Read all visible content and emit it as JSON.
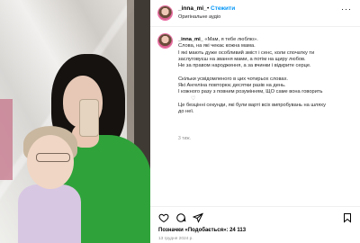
{
  "header": {
    "username": "_inna_mi_",
    "separator": "•",
    "follow_label": "Стежити",
    "audio_label": "Оригінальне аудіо",
    "more_icon": "more-horizontal-icon"
  },
  "caption": {
    "username": "_inna_mi_",
    "lines": [
      "«Мам, я тебе люблю».",
      "Слова, на які чекає кожна мама.",
      "І які мають дуже особливий зміст і сенс, коли спочатку ти",
      "заслуговуєш на звання мами, а потім на щиру любов.",
      "Не за правом народження, а за вчинки і відкрите серце.",
      "Скільки усвідомленого в цих чотирьох словах.",
      "Які Ангеліна повторює десятки разів на день.",
      "І кожного разу з повним розумінням, ЩО саме вона говорить",
      "Це безцінні секунди, які були варті всіх випробувань на шляху",
      "до неї."
    ],
    "time_ago": "3 тиж."
  },
  "footer": {
    "likes_text": "Позначки «Подобається»: 24 113",
    "date_text": "13 грудня 2024 р."
  },
  "icons": {
    "like": "heart-icon",
    "comment": "comment-icon",
    "share": "share-icon",
    "save": "bookmark-icon"
  },
  "colors": {
    "accent": "#0095f6",
    "muted": "#8e8e8e",
    "hoodie": "#2fa33a"
  }
}
